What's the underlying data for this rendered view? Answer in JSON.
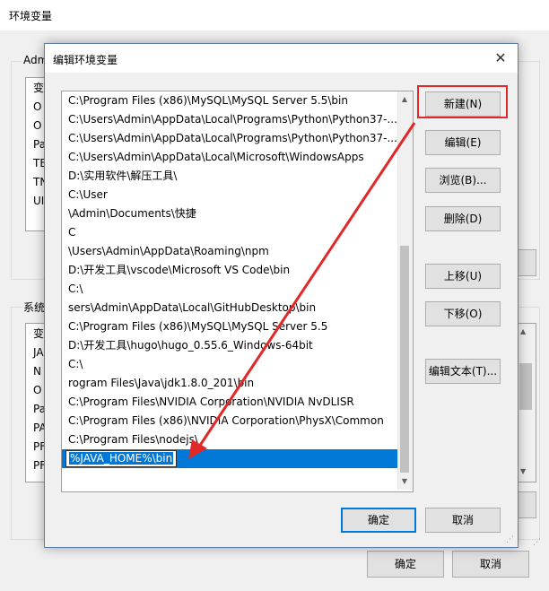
{
  "background_window": {
    "title": "环境变量",
    "user_group_label": "Adm",
    "user_list_items": [
      "变",
      "O",
      "O",
      "Pa",
      "TE",
      "TN",
      "UI"
    ],
    "system_group_label": "系统",
    "system_list_items": [
      "变",
      "JA",
      "N",
      "O",
      "Pa",
      "PA",
      "PF",
      "PF"
    ],
    "ok_label": "确定",
    "cancel_label": "取消"
  },
  "dialog": {
    "title": "编辑环境变量",
    "close_glyph": "✕",
    "path_entries": [
      "C:\\Program Files (x86)\\MySQL\\MySQL Server 5.5\\bin",
      "C:\\Users\\Admin\\AppData\\Local\\Programs\\Python\\Python37-...",
      "C:\\Users\\Admin\\AppData\\Local\\Programs\\Python\\Python37-...",
      "C:\\Users\\Admin\\AppData\\Local\\Microsoft\\WindowsApps",
      "D:\\实用软件\\解压工具\\",
      "C:\\User",
      "\\Admin\\Documents\\快捷",
      "C",
      "\\Users\\Admin\\AppData\\Roaming\\npm",
      "D:\\开发工具\\vscode\\Microsoft VS Code\\bin",
      "C:\\",
      "sers\\Admin\\AppData\\Local\\GitHubDesktop\\bin",
      "C:\\Program Files (x86)\\MySQL\\MySQL Server 5.5",
      "D:\\开发工具\\hugo\\hugo_0.55.6_Windows-64bit",
      "C:\\",
      "rogram Files\\Java\\jdk1.8.0_201\\bin",
      "C:\\Program Files\\NVIDIA Corporation\\NVIDIA NvDLISR",
      "C:\\Program Files (x86)\\NVIDIA Corporation\\PhysX\\Common",
      "C:\\Program Files\\nodejs\\"
    ],
    "editing_value": "%JAVA_HOME%\\bin",
    "buttons": {
      "new": "新建(N)",
      "edit": "编辑(E)",
      "browse": "浏览(B)...",
      "delete": "删除(D)",
      "move_up": "上移(U)",
      "move_down": "下移(O)",
      "edit_text": "编辑文本(T)..."
    },
    "ok_label": "确定",
    "cancel_label": "取消"
  },
  "colors": {
    "selection": "#0078d7",
    "highlight_annotation": "#e02828"
  },
  "icons": {
    "close": "close-icon",
    "scroll_up": "scroll-up-icon",
    "scroll_down": "scroll-down-icon",
    "annotation_arrow": "red-arrow-annotation"
  }
}
